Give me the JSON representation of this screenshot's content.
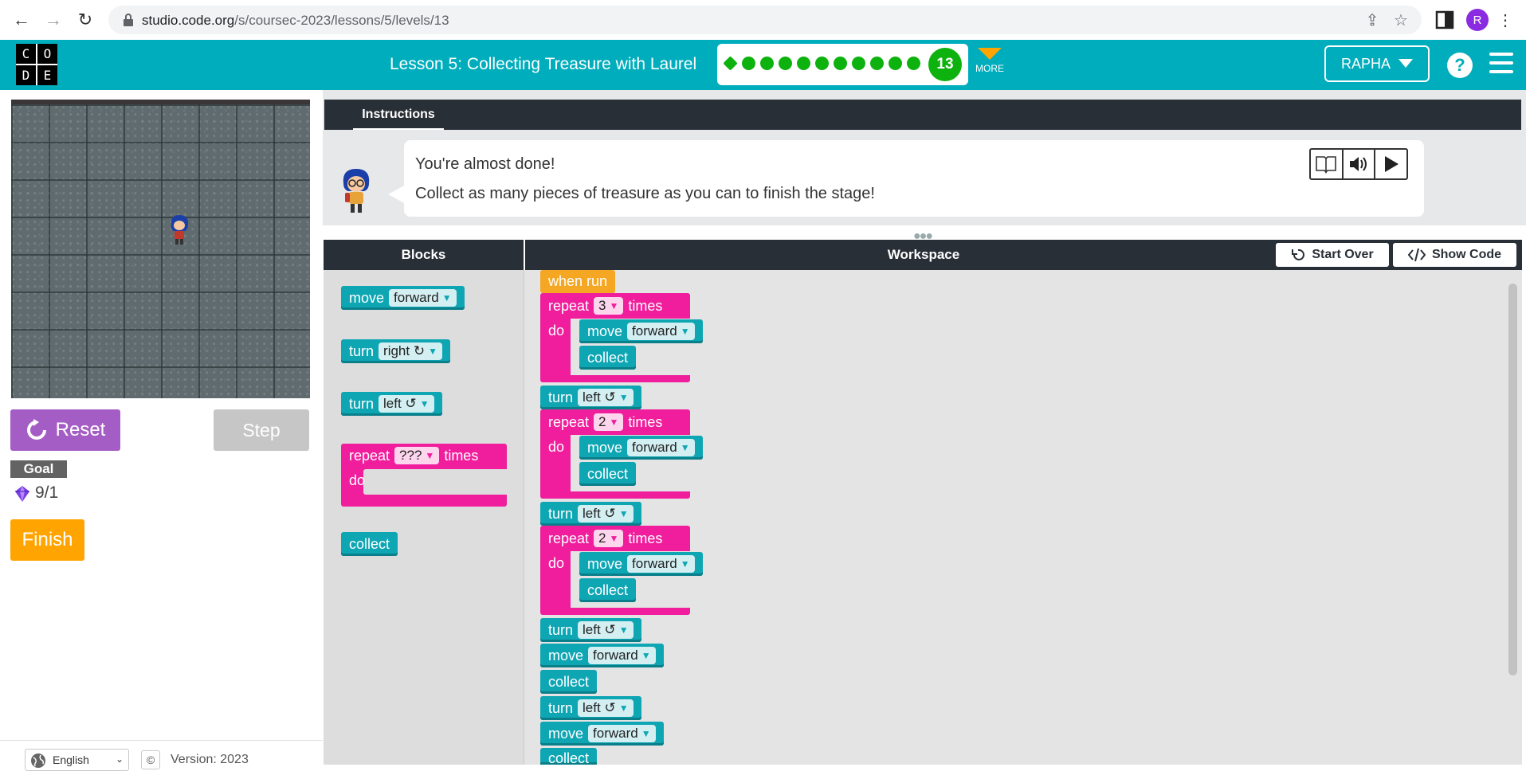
{
  "browser": {
    "url_host": "studio.code.org",
    "url_path": "/s/coursec-2023/lessons/5/levels/13",
    "profile_initial": "R"
  },
  "header": {
    "logo_letters": [
      "C",
      "O",
      "D",
      "E"
    ],
    "lesson_title": "Lesson 5: Collecting Treasure with Laurel",
    "current_level": "13",
    "more_label": "MORE",
    "user_label": "RAPHA",
    "help_label": "?"
  },
  "left": {
    "reset_label": "Reset",
    "step_label": "Step",
    "goal_label": "Goal",
    "goal_count": "9/1",
    "finish_label": "Finish",
    "language": "English",
    "copyright": "©",
    "version": "Version: 2023"
  },
  "instructions": {
    "tab_label": "Instructions",
    "line1": "You're almost done!",
    "line2": "Collect as many pieces of treasure as you can to finish the stage!"
  },
  "workspace_header": {
    "blocks_title": "Blocks",
    "workspace_title": "Workspace",
    "start_over": "Start Over",
    "show_code": "Show Code"
  },
  "toolbox": {
    "move": {
      "keyword": "move",
      "value": "forward"
    },
    "turn_right": {
      "keyword": "turn",
      "value": "right ↻"
    },
    "turn_left": {
      "keyword": "turn",
      "value": "left ↺"
    },
    "repeat": {
      "keyword": "repeat",
      "value": "???",
      "suffix": "times",
      "do": "do"
    },
    "collect": {
      "keyword": "collect"
    }
  },
  "program": {
    "when_run": "when run",
    "repeat_kw": "repeat",
    "times_kw": "times",
    "do_kw": "do",
    "move_kw": "move",
    "turn_kw": "turn",
    "collect_kw": "collect",
    "forward": "forward",
    "left": "left ↺",
    "repeat1_count": "3",
    "repeat2_count": "2",
    "repeat3_count": "2"
  },
  "colors": {
    "header": "#00adbc",
    "teal_block": "#0fa6b4",
    "pink_block": "#f01e9c",
    "event_block": "#f5a623",
    "reset": "#a55dc6",
    "finish": "#ffa400",
    "progress": "#0eb20e"
  }
}
